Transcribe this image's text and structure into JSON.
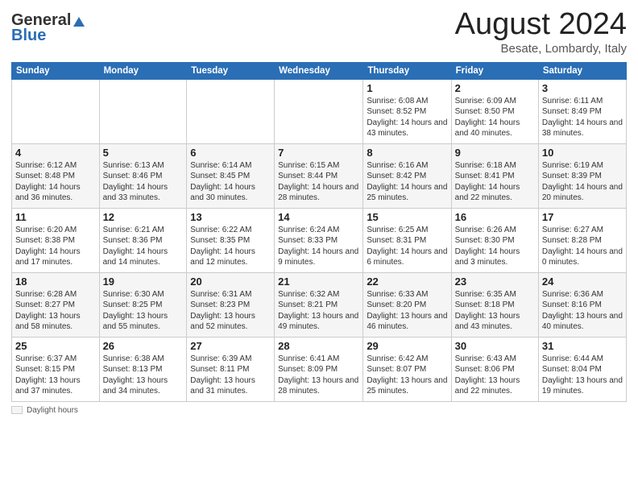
{
  "header": {
    "logo_general": "General",
    "logo_blue": "Blue",
    "title": "August 2024",
    "location": "Besate, Lombardy, Italy"
  },
  "weekdays": [
    "Sunday",
    "Monday",
    "Tuesday",
    "Wednesday",
    "Thursday",
    "Friday",
    "Saturday"
  ],
  "weeks": [
    [
      {
        "day": "",
        "info": ""
      },
      {
        "day": "",
        "info": ""
      },
      {
        "day": "",
        "info": ""
      },
      {
        "day": "",
        "info": ""
      },
      {
        "day": "1",
        "info": "Sunrise: 6:08 AM\nSunset: 8:52 PM\nDaylight: 14 hours and 43 minutes."
      },
      {
        "day": "2",
        "info": "Sunrise: 6:09 AM\nSunset: 8:50 PM\nDaylight: 14 hours and 40 minutes."
      },
      {
        "day": "3",
        "info": "Sunrise: 6:11 AM\nSunset: 8:49 PM\nDaylight: 14 hours and 38 minutes."
      }
    ],
    [
      {
        "day": "4",
        "info": "Sunrise: 6:12 AM\nSunset: 8:48 PM\nDaylight: 14 hours and 36 minutes."
      },
      {
        "day": "5",
        "info": "Sunrise: 6:13 AM\nSunset: 8:46 PM\nDaylight: 14 hours and 33 minutes."
      },
      {
        "day": "6",
        "info": "Sunrise: 6:14 AM\nSunset: 8:45 PM\nDaylight: 14 hours and 30 minutes."
      },
      {
        "day": "7",
        "info": "Sunrise: 6:15 AM\nSunset: 8:44 PM\nDaylight: 14 hours and 28 minutes."
      },
      {
        "day": "8",
        "info": "Sunrise: 6:16 AM\nSunset: 8:42 PM\nDaylight: 14 hours and 25 minutes."
      },
      {
        "day": "9",
        "info": "Sunrise: 6:18 AM\nSunset: 8:41 PM\nDaylight: 14 hours and 22 minutes."
      },
      {
        "day": "10",
        "info": "Sunrise: 6:19 AM\nSunset: 8:39 PM\nDaylight: 14 hours and 20 minutes."
      }
    ],
    [
      {
        "day": "11",
        "info": "Sunrise: 6:20 AM\nSunset: 8:38 PM\nDaylight: 14 hours and 17 minutes."
      },
      {
        "day": "12",
        "info": "Sunrise: 6:21 AM\nSunset: 8:36 PM\nDaylight: 14 hours and 14 minutes."
      },
      {
        "day": "13",
        "info": "Sunrise: 6:22 AM\nSunset: 8:35 PM\nDaylight: 14 hours and 12 minutes."
      },
      {
        "day": "14",
        "info": "Sunrise: 6:24 AM\nSunset: 8:33 PM\nDaylight: 14 hours and 9 minutes."
      },
      {
        "day": "15",
        "info": "Sunrise: 6:25 AM\nSunset: 8:31 PM\nDaylight: 14 hours and 6 minutes."
      },
      {
        "day": "16",
        "info": "Sunrise: 6:26 AM\nSunset: 8:30 PM\nDaylight: 14 hours and 3 minutes."
      },
      {
        "day": "17",
        "info": "Sunrise: 6:27 AM\nSunset: 8:28 PM\nDaylight: 14 hours and 0 minutes."
      }
    ],
    [
      {
        "day": "18",
        "info": "Sunrise: 6:28 AM\nSunset: 8:27 PM\nDaylight: 13 hours and 58 minutes."
      },
      {
        "day": "19",
        "info": "Sunrise: 6:30 AM\nSunset: 8:25 PM\nDaylight: 13 hours and 55 minutes."
      },
      {
        "day": "20",
        "info": "Sunrise: 6:31 AM\nSunset: 8:23 PM\nDaylight: 13 hours and 52 minutes."
      },
      {
        "day": "21",
        "info": "Sunrise: 6:32 AM\nSunset: 8:21 PM\nDaylight: 13 hours and 49 minutes."
      },
      {
        "day": "22",
        "info": "Sunrise: 6:33 AM\nSunset: 8:20 PM\nDaylight: 13 hours and 46 minutes."
      },
      {
        "day": "23",
        "info": "Sunrise: 6:35 AM\nSunset: 8:18 PM\nDaylight: 13 hours and 43 minutes."
      },
      {
        "day": "24",
        "info": "Sunrise: 6:36 AM\nSunset: 8:16 PM\nDaylight: 13 hours and 40 minutes."
      }
    ],
    [
      {
        "day": "25",
        "info": "Sunrise: 6:37 AM\nSunset: 8:15 PM\nDaylight: 13 hours and 37 minutes."
      },
      {
        "day": "26",
        "info": "Sunrise: 6:38 AM\nSunset: 8:13 PM\nDaylight: 13 hours and 34 minutes."
      },
      {
        "day": "27",
        "info": "Sunrise: 6:39 AM\nSunset: 8:11 PM\nDaylight: 13 hours and 31 minutes."
      },
      {
        "day": "28",
        "info": "Sunrise: 6:41 AM\nSunset: 8:09 PM\nDaylight: 13 hours and 28 minutes."
      },
      {
        "day": "29",
        "info": "Sunrise: 6:42 AM\nSunset: 8:07 PM\nDaylight: 13 hours and 25 minutes."
      },
      {
        "day": "30",
        "info": "Sunrise: 6:43 AM\nSunset: 8:06 PM\nDaylight: 13 hours and 22 minutes."
      },
      {
        "day": "31",
        "info": "Sunrise: 6:44 AM\nSunset: 8:04 PM\nDaylight: 13 hours and 19 minutes."
      }
    ]
  ],
  "footer": {
    "label": "Daylight hours"
  }
}
